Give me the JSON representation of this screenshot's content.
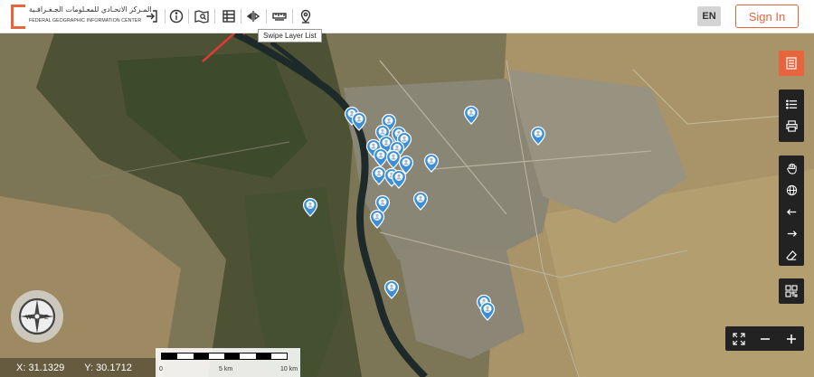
{
  "header": {
    "logo_arabic": "المـركز الاتحـادي للمعـلومات الجـغـرافـية",
    "logo_english": "FEDERAL GEOGRAPHIC INFORMATION CENTER",
    "language_label": "EN",
    "signin_label": "Sign In",
    "tools": [
      "login-icon",
      "info-icon",
      "map-search-icon",
      "layer-list-icon",
      "swipe-icon",
      "measure-icon",
      "location-pin-icon"
    ]
  },
  "tooltip": {
    "text": "Swipe Layer List"
  },
  "side_tools": {
    "top": "document-list-icon",
    "group1": [
      "list-icon",
      "print-icon"
    ],
    "group2": [
      "pan-hand-icon",
      "globe-icon",
      "arrow-left-icon",
      "arrow-right-icon",
      "eraser-icon"
    ],
    "qr": "qr-code-icon"
  },
  "coordinates": {
    "x": "X: 31.1329",
    "y": "Y: 30.1712"
  },
  "scale": {
    "labels": [
      "0",
      "5 km",
      "10 km"
    ]
  },
  "colors": {
    "accent": "#e8643c",
    "toolbar_dark": "#222222",
    "pin": "#3a8fd8"
  }
}
